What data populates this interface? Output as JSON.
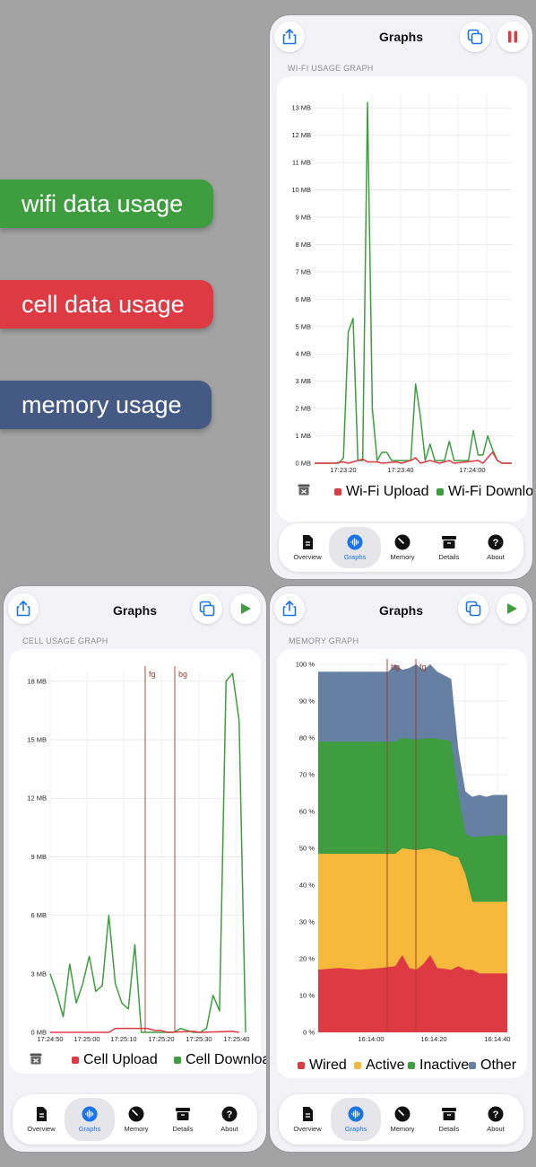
{
  "pills": {
    "wifi": "wifi data usage",
    "cell": "cell data usage",
    "memory": "memory usage"
  },
  "colors": {
    "green": "#3e9e3f",
    "red": "#dd3a44",
    "blue": "#445a85",
    "orange": "#f6b93b",
    "slate": "#6680a4",
    "accent": "#1a73e8"
  },
  "tabs": [
    "Overview",
    "Graphs",
    "Memory",
    "Details",
    "About"
  ],
  "wifi_panel": {
    "title": "Graphs",
    "section": "WI-FI USAGE GRAPH",
    "legend": [
      "Wi-Fi Upload",
      "Wi-Fi Download"
    ]
  },
  "cell_panel": {
    "title": "Graphs",
    "section": "CELL USAGE GRAPH",
    "legend": [
      "Cell Upload",
      "Cell Download"
    ],
    "markers": [
      "fg",
      "bg"
    ]
  },
  "memory_panel": {
    "title": "Graphs",
    "section": "MEMORY GRAPH",
    "legend": [
      "Wired",
      "Active",
      "Inactive",
      "Other"
    ],
    "markers": [
      "bg",
      "fg"
    ]
  },
  "chart_data": [
    {
      "type": "line",
      "yticks": [
        "0 MB",
        "1 MB",
        "2 MB",
        "3 MB",
        "4 MB",
        "5 MB",
        "6 MB",
        "7 MB",
        "8 MB",
        "9 MB",
        "10 MB",
        "11 MB",
        "12 MB",
        "13 MB"
      ],
      "xticks": [
        "17:23:20",
        "17:23:40",
        "17:24:00"
      ],
      "ylim": [
        0,
        13.5
      ],
      "series": [
        {
          "name": "Wi-Fi Upload",
          "color": "#dd3a44",
          "points": [
            [
              0,
              0
            ],
            [
              4,
              0
            ],
            [
              6,
              0.05
            ],
            [
              7,
              0
            ],
            [
              10,
              0.15
            ],
            [
              11,
              0.05
            ],
            [
              13,
              0.05
            ],
            [
              14,
              0
            ],
            [
              17,
              0.05
            ],
            [
              18,
              0
            ],
            [
              20,
              0.1
            ],
            [
              21,
              0.2
            ],
            [
              22,
              0
            ],
            [
              24,
              0.1
            ],
            [
              26,
              0
            ],
            [
              28,
              0.1
            ],
            [
              29,
              0
            ],
            [
              34,
              0.1
            ],
            [
              35,
              0
            ],
            [
              37,
              0.4
            ],
            [
              38,
              0.1
            ],
            [
              39,
              0
            ],
            [
              41,
              0
            ]
          ]
        },
        {
          "name": "Wi-Fi Download",
          "color": "#3e9e3f",
          "points": [
            [
              0,
              0
            ],
            [
              1,
              0
            ],
            [
              2,
              0
            ],
            [
              3,
              0
            ],
            [
              4,
              0
            ],
            [
              5,
              0
            ],
            [
              6,
              0.2
            ],
            [
              7,
              4.8
            ],
            [
              8,
              5.3
            ],
            [
              9,
              0.1
            ],
            [
              10,
              0.1
            ],
            [
              11,
              13.2
            ],
            [
              12,
              2.0
            ],
            [
              13,
              0.1
            ],
            [
              14,
              0.4
            ],
            [
              15,
              0.4
            ],
            [
              16,
              0.1
            ],
            [
              17,
              0.1
            ],
            [
              18,
              0.1
            ],
            [
              19,
              0.1
            ],
            [
              20,
              0.1
            ],
            [
              21,
              2.9
            ],
            [
              22,
              1.7
            ],
            [
              23,
              0.1
            ],
            [
              24,
              0.7
            ],
            [
              25,
              0.1
            ],
            [
              26,
              0.1
            ],
            [
              27,
              0.1
            ],
            [
              28,
              0.8
            ],
            [
              29,
              0.1
            ],
            [
              30,
              0.1
            ],
            [
              31,
              0.1
            ],
            [
              32,
              0.1
            ],
            [
              33,
              1.2
            ],
            [
              34,
              0.3
            ],
            [
              35,
              0.3
            ],
            [
              36,
              1.0
            ],
            [
              37,
              0.5
            ],
            [
              38,
              0.1
            ],
            [
              39,
              0
            ],
            [
              40,
              0
            ],
            [
              41,
              0
            ]
          ]
        }
      ]
    },
    {
      "type": "line",
      "yticks": [
        "0 MB",
        "3 MB",
        "6 MB",
        "9 MB",
        "12 MB",
        "15 MB",
        "18 MB"
      ],
      "xticks": [
        "17:24:50",
        "17:25:00",
        "17:25:10",
        "17:25:20",
        "17:25:30",
        "17:25:40"
      ],
      "ylim": [
        0,
        18.5
      ],
      "series": [
        {
          "name": "Cell Upload",
          "color": "#dd3a44",
          "points": [
            [
              0,
              0
            ],
            [
              9,
              0
            ],
            [
              10,
              0.2
            ],
            [
              15,
              0.2
            ],
            [
              16,
              0.1
            ],
            [
              17,
              0.1
            ],
            [
              18,
              0
            ],
            [
              22,
              0.05
            ],
            [
              23,
              0
            ],
            [
              28,
              0.05
            ],
            [
              29,
              0
            ]
          ]
        },
        {
          "name": "Cell Download",
          "color": "#3e9e3f",
          "points": [
            [
              0,
              3.0
            ],
            [
              1,
              2.0
            ],
            [
              2,
              0.8
            ],
            [
              3,
              3.5
            ],
            [
              4,
              1.5
            ],
            [
              5,
              2.5
            ],
            [
              6,
              3.9
            ],
            [
              7,
              2.1
            ],
            [
              8,
              2.4
            ],
            [
              9,
              6.0
            ],
            [
              10,
              2.5
            ],
            [
              11,
              1.5
            ],
            [
              12,
              1.2
            ],
            [
              13,
              4.5
            ],
            [
              14,
              0
            ],
            [
              19,
              0
            ],
            [
              20,
              0.2
            ],
            [
              21,
              0.1
            ],
            [
              22,
              0
            ],
            [
              23,
              0
            ],
            [
              24,
              0.2
            ],
            [
              25,
              1.9
            ],
            [
              26,
              1.1
            ],
            [
              27,
              18.0
            ],
            [
              28,
              18.4
            ],
            [
              29,
              16.0
            ],
            [
              30,
              0
            ]
          ]
        }
      ]
    },
    {
      "type": "area",
      "yticks": [
        "0 %",
        "10 %",
        "20 %",
        "30 %",
        "40 %",
        "50 %",
        "60 %",
        "70 %",
        "80 %",
        "90 %",
        "100 %"
      ],
      "xticks": [
        "16:14:00",
        "16:14:20",
        "16:14:40"
      ],
      "ylim": [
        0,
        100
      ],
      "series": [
        {
          "name": "Wired",
          "color": "#dd3a44",
          "points": [
            [
              0,
              17
            ],
            [
              3,
              17.5
            ],
            [
              6,
              17
            ],
            [
              9,
              17.5
            ],
            [
              11,
              18
            ],
            [
              12,
              21
            ],
            [
              13,
              17.5
            ],
            [
              14,
              17
            ],
            [
              15,
              18.5
            ],
            [
              16,
              21
            ],
            [
              17,
              17.5
            ],
            [
              19,
              17
            ],
            [
              20,
              18
            ],
            [
              21,
              17
            ],
            [
              22,
              17
            ],
            [
              23,
              16
            ],
            [
              24,
              16
            ],
            [
              27,
              16
            ]
          ]
        },
        {
          "name": "Active",
          "color": "#f6b93b",
          "points": [
            [
              0,
              48.5
            ],
            [
              6,
              48.5
            ],
            [
              11,
              48.5
            ],
            [
              12,
              50
            ],
            [
              14,
              49.5
            ],
            [
              16,
              50
            ],
            [
              18,
              49
            ],
            [
              19,
              48
            ],
            [
              20,
              47.5
            ],
            [
              21,
              43
            ],
            [
              22,
              35.5
            ],
            [
              23,
              35.5
            ],
            [
              25,
              35.5
            ],
            [
              27,
              35.5
            ]
          ]
        },
        {
          "name": "Inactive",
          "color": "#3e9e3f",
          "points": [
            [
              0,
              79
            ],
            [
              6,
              79
            ],
            [
              11,
              79
            ],
            [
              12,
              80
            ],
            [
              14,
              79.5
            ],
            [
              16,
              80
            ],
            [
              18,
              79.5
            ],
            [
              19,
              79
            ],
            [
              20,
              65
            ],
            [
              21,
              54
            ],
            [
              22,
              53
            ],
            [
              25,
              53.5
            ],
            [
              27,
              53.5
            ]
          ]
        },
        {
          "name": "Other",
          "color": "#6680a4",
          "points": [
            [
              0,
              98
            ],
            [
              6,
              98
            ],
            [
              10,
              98
            ],
            [
              11,
              100
            ],
            [
              12,
              98.5
            ],
            [
              13,
              99
            ],
            [
              14,
              100
            ],
            [
              15,
              98.5
            ],
            [
              16,
              100
            ],
            [
              17,
              98
            ],
            [
              18,
              97
            ],
            [
              19,
              96
            ],
            [
              20,
              77
            ],
            [
              21,
              65.5
            ],
            [
              22,
              64
            ],
            [
              23,
              64.5
            ],
            [
              24,
              64
            ],
            [
              25,
              64.5
            ],
            [
              27,
              64.5
            ]
          ]
        }
      ]
    }
  ]
}
